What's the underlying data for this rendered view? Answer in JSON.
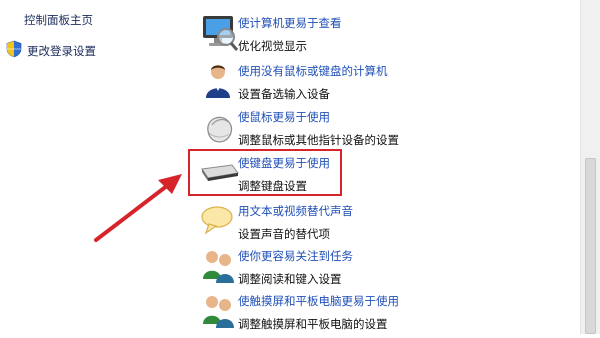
{
  "sidebar": {
    "home_label": "控制面板主页",
    "items": [
      {
        "label": "更改登录设置",
        "icon": "shield-icon"
      }
    ]
  },
  "options": [
    {
      "title": "使计算机更易于查看",
      "desc": "优化视觉显示",
      "icon": "display-icon"
    },
    {
      "title": "使用没有鼠标或键盘的计算机",
      "desc": "设置备选输入设备",
      "icon": "person-icon"
    },
    {
      "title": "使鼠标更易于使用",
      "desc": "调整鼠标或其他指针设备的设置",
      "icon": "mouse-icon"
    },
    {
      "title": "使键盘更易于使用",
      "desc": "调整键盘设置",
      "icon": "keyboard-icon",
      "highlighted": true
    },
    {
      "title": "用文本或视频替代声音",
      "desc": "设置声音的替代项",
      "icon": "speech-bubble-icon"
    },
    {
      "title": "使你更容易关注到任务",
      "desc": "调整阅读和键入设置",
      "icon": "people-icon"
    },
    {
      "title": "使触摸屏和平板电脑更易于使用",
      "desc": "调整触摸屏和平板电脑的设置",
      "icon": "people-icon"
    }
  ],
  "colors": {
    "link": "#1f4fb6",
    "highlight": "#d7242a"
  }
}
